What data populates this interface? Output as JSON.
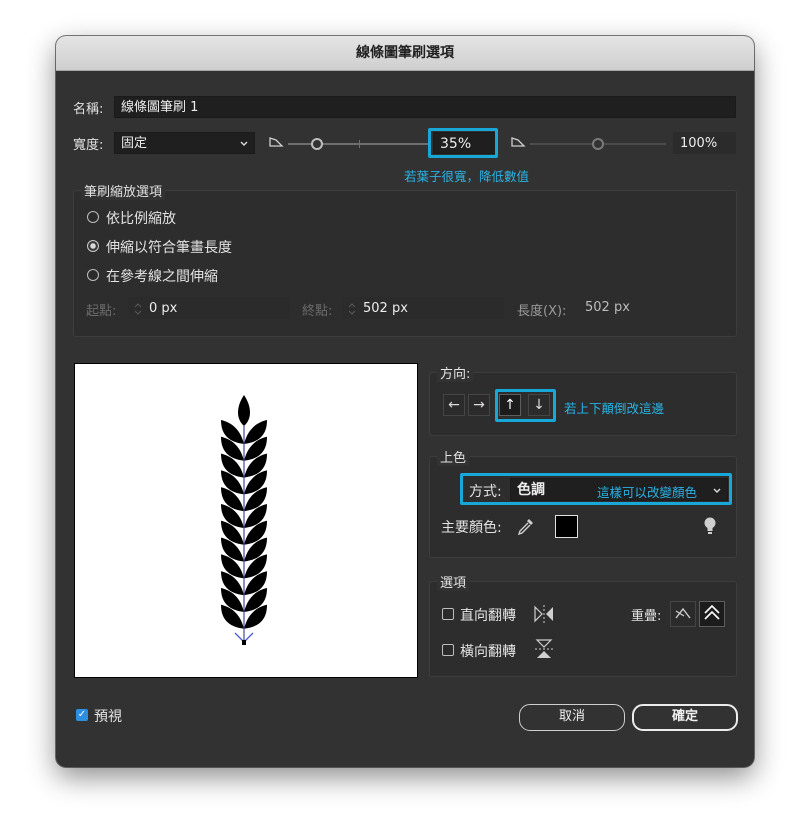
{
  "dialog": {
    "title": "線條圖筆刷選項"
  },
  "name": {
    "label": "名稱:",
    "value": "線條圖筆刷 1"
  },
  "width": {
    "label": "寬度:",
    "mode": "固定",
    "value": "35%",
    "max_value": "100%",
    "hint": "若葉子很寬，降低數值",
    "slider_level": 0.35
  },
  "scale": {
    "title": "筆刷縮放選項",
    "options": [
      {
        "label": "依比例縮放",
        "selected": false
      },
      {
        "label": "伸縮以符合筆畫長度",
        "selected": true
      },
      {
        "label": "在參考線之間伸縮",
        "selected": false
      }
    ],
    "start_label": "起點:",
    "start_value": "0 px",
    "end_label": "終點:",
    "end_value": "502 px",
    "length_label": "長度(X):",
    "length_value": "502 px"
  },
  "direction": {
    "title": "方向:",
    "arrows": [
      "←",
      "→",
      "↑",
      "↓"
    ],
    "hint": "若上下顛倒改這邊"
  },
  "colorization": {
    "title": "上色",
    "method_label": "方式:",
    "method_value": "色調",
    "hint": "這樣可以改變顏色",
    "key_color_label": "主要顏色:",
    "key_color": "#000000"
  },
  "options": {
    "title": "選項",
    "flip_along": "直向翻轉",
    "flip_across": "橫向翻轉",
    "overlap_label": "重疊:"
  },
  "preview": {
    "label": "預視",
    "checked": true
  },
  "buttons": {
    "cancel": "取消",
    "ok": "確定"
  },
  "colors": {
    "accent": "#18a8d8",
    "hint_text": "#29b2e4",
    "dialog_bg": "#323232"
  }
}
